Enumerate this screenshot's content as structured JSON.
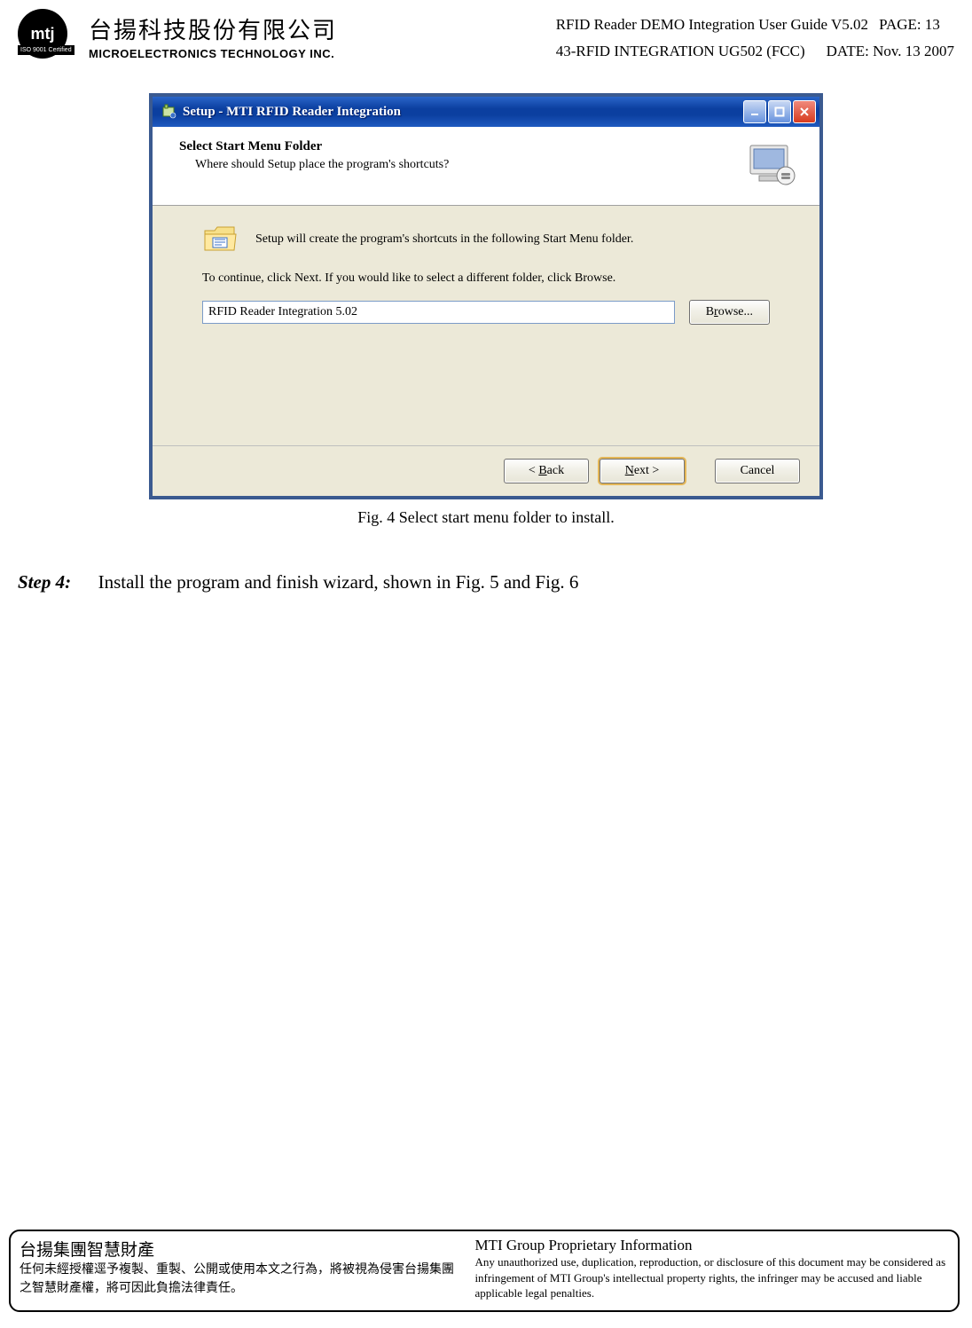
{
  "header": {
    "logo_text": "mtj",
    "iso_text": "ISO 9001 Certified",
    "company_cn": "台揚科技股份有限公司",
    "company_en": "MICROELECTRONICS TECHNOLOGY INC.",
    "guide_title": "RFID Reader DEMO Integration User Guide V5.02",
    "page_label": "PAGE: 13",
    "doc_code": "43-RFID  INTEGRATION  UG502  (FCC)",
    "date_label": "DATE:  Nov.  13  2007"
  },
  "installer": {
    "title": "Setup - MTI RFID Reader Integration",
    "header_heading": "Select Start Menu Folder",
    "header_sub": "Where should Setup place the program's shortcuts?",
    "body_line1": "Setup will create the program's shortcuts in the following Start Menu folder.",
    "body_line2": "To continue, click Next. If you would like to select a different folder, click Browse.",
    "folder_value": "RFID Reader Integration 5.02",
    "browse_label": "Browse...",
    "back_label": "< Back",
    "next_label": "Next >",
    "cancel_label": "Cancel"
  },
  "caption": "Fig. 4    Select start menu folder to install.",
  "step": {
    "label": "Step 4:",
    "text": "Install the program and finish wizard, shown in Fig. 5 and Fig. 6"
  },
  "footer": {
    "left_title": "台揚集團智慧財產",
    "left_body": "任何未經授權逕予複製、重製、公開或使用本文之行為，將被視為侵害台揚集團之智慧財產權，將可因此負擔法律責任。",
    "right_title": "MTI Group Proprietary Information",
    "right_body": "Any unauthorized use, duplication, reproduction, or disclosure of this document may be considered as infringement of MTI Group's intellectual property rights, the infringer may be accused and liable applicable legal penalties."
  }
}
